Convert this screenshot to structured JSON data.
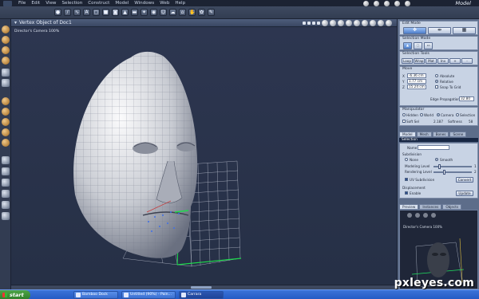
{
  "app": {
    "title": "Model"
  },
  "menu": [
    "File",
    "Edit",
    "View",
    "Selection",
    "Construct",
    "Model",
    "Windows",
    "Web",
    "Help"
  ],
  "viewport": {
    "title": "Vertex Object of Doc1",
    "camera_label": "Director's Camera 100%"
  },
  "panel": {
    "edit_mode": "Edit Mode",
    "selection_mode": "Selection Mode",
    "selection_tools": "Selection Tools",
    "sel_tools": [
      "Loop",
      "Wrap",
      "Mat",
      "Inv",
      "+",
      "-"
    ],
    "move": {
      "title": "Move",
      "x_label": "X",
      "x": "-6.36 cm",
      "y_label": "Y",
      "y": "1.77 cm",
      "z_label": "Z",
      "z": "15.24 cm",
      "absolute": "Absolute",
      "relative": "Relative",
      "snap": "Snap To Grid",
      "edge_prop_label": "Edge Propagation",
      "edge_prop_value": "32.80"
    },
    "manipulator": {
      "title": "Manipulator",
      "options": [
        "Hidden",
        "World",
        "Camera",
        "Selection"
      ],
      "soft_sel": "Soft Sel",
      "soft_val": "2.187",
      "softness": "Softness",
      "softness_val": "58"
    },
    "tabs": [
      "Model",
      "Mesh",
      "Bones",
      "Scene"
    ],
    "selection_bar": "Selection",
    "name_label": "Name",
    "subdivision": {
      "title": "Subdivision",
      "none": "None",
      "smooth": "Smooth",
      "modeling_level": "Modeling Level",
      "modeling_val": "1",
      "rendering_level": "Rendering Level",
      "rendering_val": "2",
      "uv_subdivision": "UV Subdivision",
      "convert": "Convert"
    },
    "displacement": {
      "title": "Displacement",
      "enable": "Enable",
      "update": "Update"
    },
    "preview_tabs": [
      "Preview",
      "Instances",
      "Objects"
    ],
    "preview_label": "Director's Camera 100%"
  },
  "taskbar": {
    "start": "start",
    "tasks": [
      "Bamboo Dock",
      "Untitled (90%) - Pain...",
      "Carrara"
    ]
  },
  "watermark": "pxleyes.com"
}
